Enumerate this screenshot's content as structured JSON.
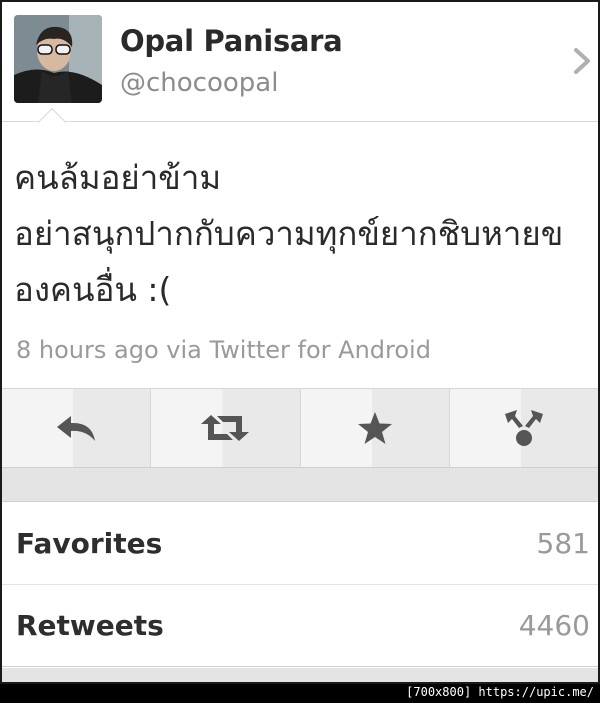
{
  "profile": {
    "name": "Opal Panisara",
    "handle": "@chocoopal",
    "avatar_icon": "profile-photo"
  },
  "tweet": {
    "lines": [
      "คนล้มอย่าข้าม",
      "อย่าสนุกปากกับความทุกข์ยากชิบหายข",
      "องคนอื่น :("
    ],
    "meta": "8 hours ago via Twitter for Android"
  },
  "actions": [
    {
      "name": "reply",
      "icon": "reply-icon"
    },
    {
      "name": "retweet",
      "icon": "retweet-icon"
    },
    {
      "name": "favorite",
      "icon": "star-icon"
    },
    {
      "name": "share",
      "icon": "share-icon"
    }
  ],
  "stats": {
    "favorites": {
      "label": "Favorites",
      "value": "581"
    },
    "retweets": {
      "label": "Retweets",
      "value": "4460"
    }
  },
  "watermark": "[700x800] https://upic.me/",
  "colors": {
    "name": "#2a2a2a",
    "secondary_text": "#9a9a9a",
    "action_icon": "#555555",
    "background": "#ffffff"
  }
}
